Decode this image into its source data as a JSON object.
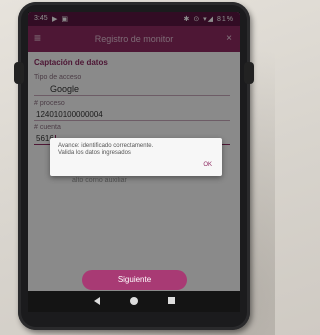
{
  "status_bar": {
    "time": "3:45",
    "left_icons": "▶ ▣",
    "right_icons": "✱ ⊙ ▾◢ 81%"
  },
  "app_bar": {
    "back_icon": "≡",
    "title": "Registro de monitor",
    "close_icon": "×"
  },
  "form": {
    "section_title": "Captación de datos",
    "fields": [
      {
        "label": "Tipo de acceso",
        "value": "Google"
      },
      {
        "label": "# proceso",
        "value": "124010100000004"
      },
      {
        "label": "# cuenta",
        "value": "5616"
      }
    ],
    "hidden_below_dialog": "alto corno auxiliar"
  },
  "dialog": {
    "message_line1": "Avance: identificado correctamente.",
    "message_line2": "Valida los datos ingresados",
    "ok_label": "OK"
  },
  "primary_button": {
    "label": "Siguiente"
  },
  "colors": {
    "primary": "#8e2a62",
    "status_bar": "#5c1742",
    "button": "#a83a74"
  }
}
